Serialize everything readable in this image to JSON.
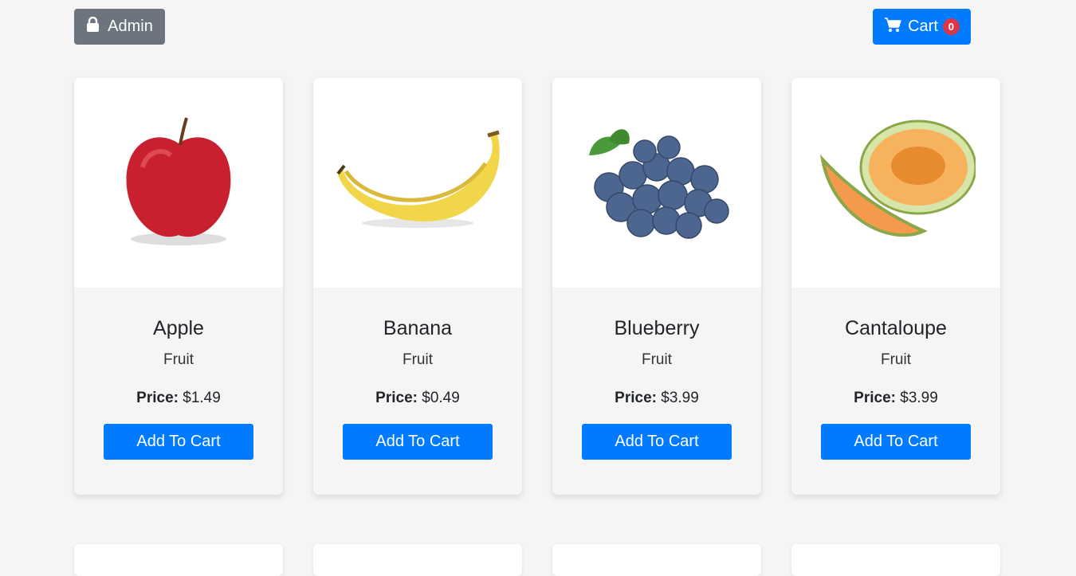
{
  "header": {
    "admin_label": "Admin",
    "admin_icon": "lock-icon",
    "cart_label": "Cart",
    "cart_icon": "shopping-cart-icon",
    "cart_count": "0"
  },
  "products": [
    {
      "name": "Apple",
      "category": "Fruit",
      "price_label": "Price:",
      "price": "$1.49",
      "button": "Add To Cart",
      "image": "apple-image"
    },
    {
      "name": "Banana",
      "category": "Fruit",
      "price_label": "Price:",
      "price": "$0.49",
      "button": "Add To Cart",
      "image": "banana-image"
    },
    {
      "name": "Blueberry",
      "category": "Fruit",
      "price_label": "Price:",
      "price": "$3.99",
      "button": "Add To Cart",
      "image": "blueberry-image"
    },
    {
      "name": "Cantaloupe",
      "category": "Fruit",
      "price_label": "Price:",
      "price": "$3.99",
      "button": "Add To Cart",
      "image": "cantaloupe-image"
    }
  ],
  "colors": {
    "primary": "#007bff",
    "secondary": "#6c757d",
    "badge": "#dc3545",
    "background": "#f5f5f5"
  }
}
